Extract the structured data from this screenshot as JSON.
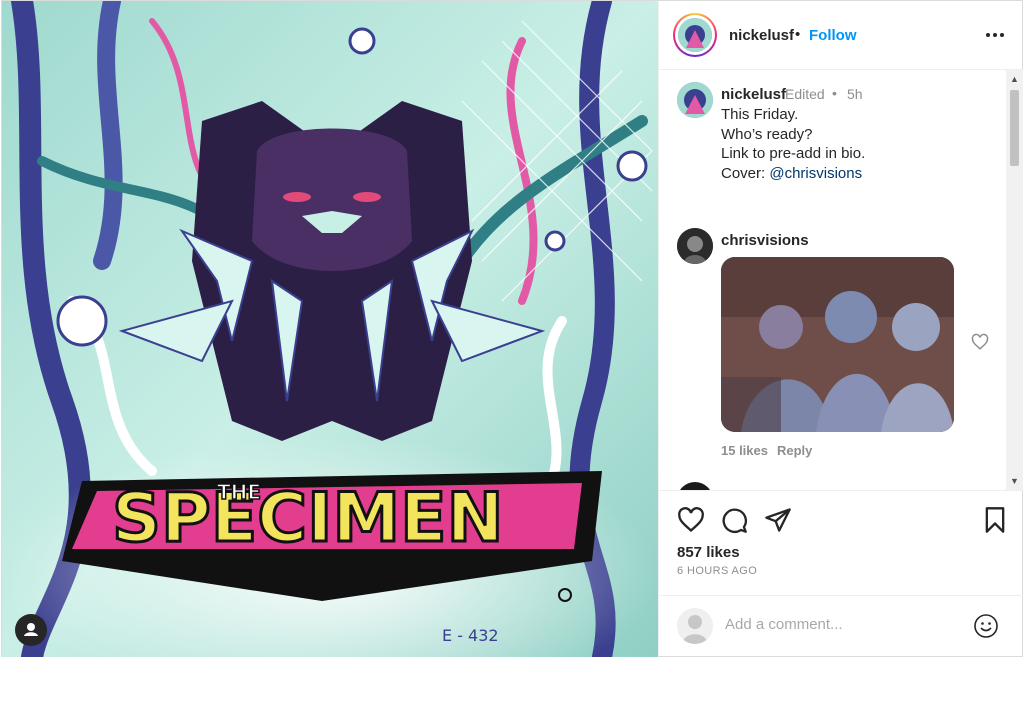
{
  "post": {
    "username": "nickelusf",
    "follow_label": "Follow",
    "separator": "•",
    "cover_art": {
      "logo_text": "SPECIMEN",
      "logo_prefix": "THE",
      "tag_text": "E - 432"
    }
  },
  "caption": {
    "username": "nickelusf",
    "edited_label": "Edited",
    "separator": "•",
    "time": "5h",
    "lines": [
      "This Friday.",
      "Who’s ready?",
      "Link to pre-add in bio."
    ],
    "cover_prefix": "Cover: ",
    "cover_mention": "@chrisvisions"
  },
  "comment": {
    "username": "chrisvisions",
    "likes": "15 likes",
    "reply_label": "Reply"
  },
  "stats": {
    "likes": "857 likes",
    "time_ago": "6 HOURS AGO"
  },
  "add_comment": {
    "placeholder": "Add a comment..."
  },
  "icons": [
    "user-tag-icon",
    "more-icon",
    "heart-icon",
    "comment-icon",
    "share-icon",
    "save-icon",
    "emoji-icon",
    "scroll-up-icon",
    "scroll-down-icon"
  ],
  "colors": {
    "accent": "#0095f6",
    "mention": "#00376b",
    "muted": "#8e8e8e"
  }
}
